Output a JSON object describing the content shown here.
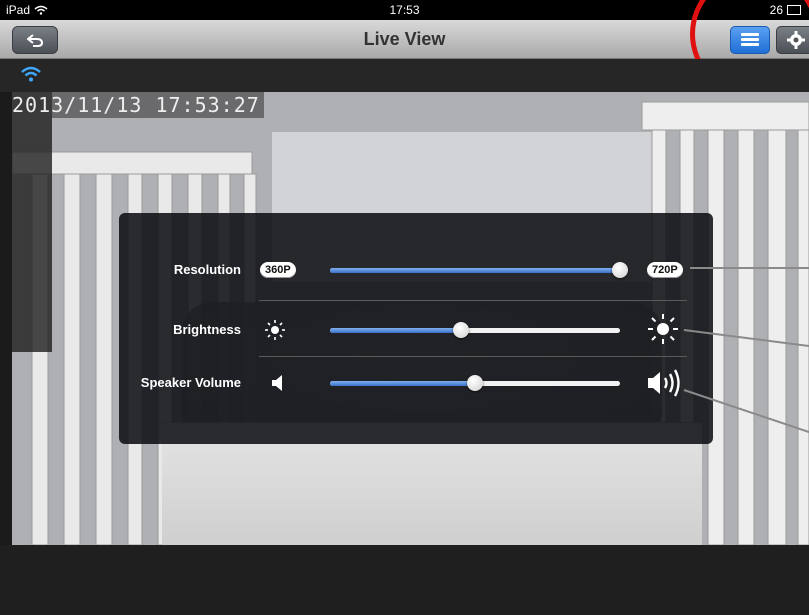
{
  "status_bar": {
    "device": "iPad",
    "time": "17:53",
    "battery": "26"
  },
  "nav": {
    "title": "Live View"
  },
  "video": {
    "timestamp": "2013/11/13 17:53:27"
  },
  "settings": {
    "resolution": {
      "label": "Resolution",
      "min_label": "360P",
      "max_label": "720P",
      "value": 1.0
    },
    "brightness": {
      "label": "Brightness",
      "value": 0.45
    },
    "speaker_volume": {
      "label": "Speaker Volume",
      "value": 0.5
    }
  },
  "colors": {
    "accent": "#2a74d8",
    "annotation": "#e01010"
  },
  "icons": {
    "back": "back-icon",
    "menu": "menu-icon",
    "settings": "gear-icon",
    "wifi": "wifi-icon",
    "brightness_low": "sun-small-icon",
    "brightness_high": "sun-large-icon",
    "volume_low": "speaker-low-icon",
    "volume_high": "speaker-high-icon"
  }
}
